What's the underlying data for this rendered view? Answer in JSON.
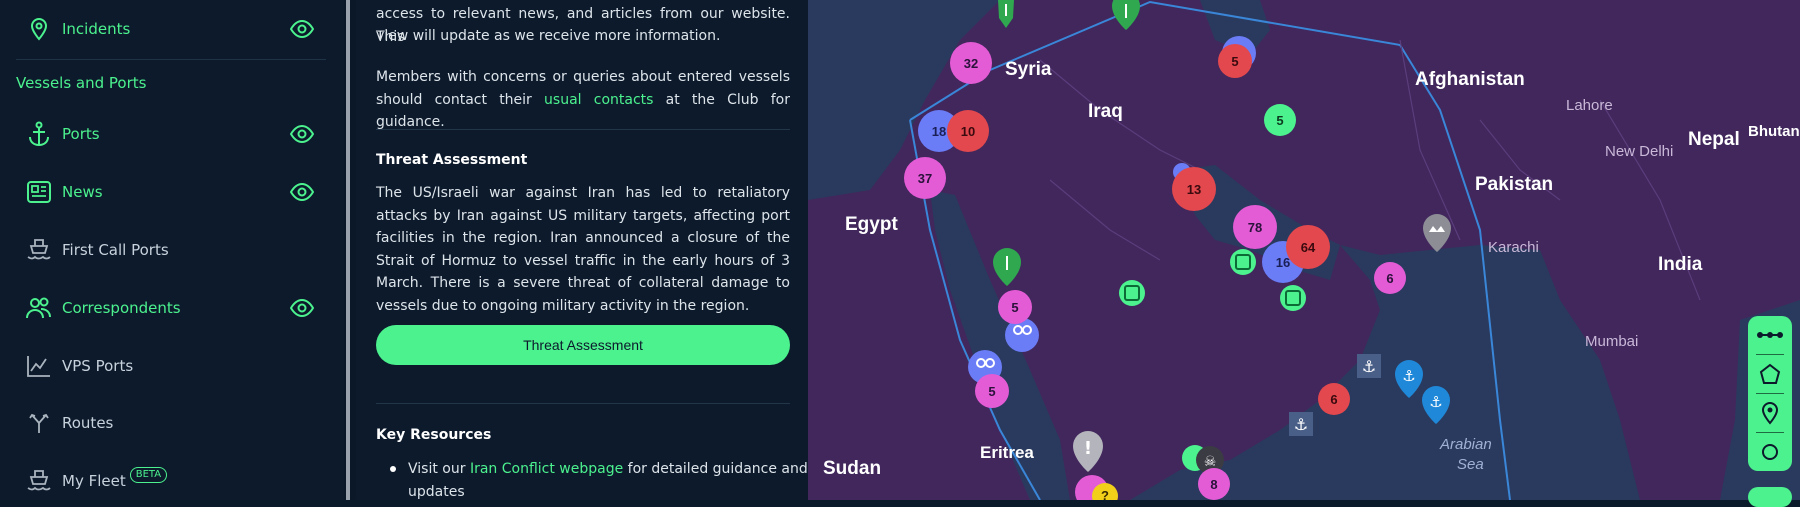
{
  "sidebar": {
    "items_top": [
      {
        "label": "Incidents",
        "icon": "map-pin-icon",
        "active": true,
        "eye": true
      }
    ],
    "section_title": "Vessels and Ports",
    "items": [
      {
        "label": "Ports",
        "icon": "anchor-icon",
        "active": true,
        "eye": true
      },
      {
        "label": "News",
        "icon": "newspaper-icon",
        "active": true,
        "eye": true
      },
      {
        "label": "First Call Ports",
        "icon": "ship-icon",
        "active": false,
        "eye": false
      },
      {
        "label": "Correspondents",
        "icon": "users-icon",
        "active": true,
        "eye": true
      },
      {
        "label": "VPS Ports",
        "icon": "chart-icon",
        "active": false,
        "eye": false
      },
      {
        "label": "Routes",
        "icon": "routes-icon",
        "active": false,
        "eye": false
      },
      {
        "label": "My Fleet",
        "icon": "fleet-icon",
        "active": false,
        "eye": false,
        "badge": "BETA"
      }
    ]
  },
  "panel": {
    "intro_line1": "access to relevant news, and articles from our website. This",
    "intro_line2": "view will update as we receive more information.",
    "members_pre": "Members with concerns or queries about entered vessels should contact their ",
    "members_link": "usual contacts",
    "members_post": " at the Club for guidance.",
    "threat_heading": "Threat Assessment",
    "threat_text": "The US/Israeli war against Iran has led to retaliatory attacks by Iran against US military targets, affecting port facilities in the region. Iran announced a closure of the Strait of Hormuz to vessel traffic in the early hours of 3 March. There is a severe threat of collateral damage to vessels due to ongoing military activity in the region.",
    "threat_button": "Threat Assessment",
    "resources_heading": "Key Resources",
    "resource_pre": "Visit our ",
    "resource_link": "Iran Conflict webpage",
    "resource_post": " for detailed guidance and updates"
  },
  "map": {
    "labels": {
      "syria": "Syria",
      "iraq": "Iraq",
      "egypt": "Egypt",
      "afghanistan": "Afghanistan",
      "pakistan": "Pakistan",
      "india": "India",
      "nepal": "Nepal",
      "bhutan": "Bhutan",
      "sudan": "Sudan",
      "eritrea": "Eritrea",
      "lahore": "Lahore",
      "new_delhi": "New Delhi",
      "karachi": "Karachi",
      "mumbai": "Mumbai",
      "arabian": "Arabian",
      "sea": "Sea"
    },
    "clusters": [
      {
        "count": "32",
        "color": "#e45bd6"
      },
      {
        "count": "18",
        "color": "#6a7cf6"
      },
      {
        "count": "10",
        "color": "#e2484d"
      },
      {
        "count": "37",
        "color": "#e45bd6"
      },
      {
        "count": "5",
        "color": "#e2484d"
      },
      {
        "count": "5",
        "color": "#4cf28e"
      },
      {
        "count": "13",
        "color": "#e2484d"
      },
      {
        "count": "78",
        "color": "#e45bd6"
      },
      {
        "count": "16",
        "color": "#6a7cf6"
      },
      {
        "count": "64",
        "color": "#e2484d"
      },
      {
        "count": "6",
        "color": "#e45bd6"
      },
      {
        "count": "5",
        "color": "#e45bd6"
      },
      {
        "count": "5",
        "color": "#e45bd6"
      },
      {
        "count": "6",
        "color": "#e2484d"
      },
      {
        "count": "8",
        "color": "#e45bd6"
      }
    ]
  },
  "colors": {
    "accent": "#4cf28e",
    "panel_bg": "#0c1a2c",
    "map_land": "#41275c",
    "map_sea": "#2a3a5e"
  }
}
